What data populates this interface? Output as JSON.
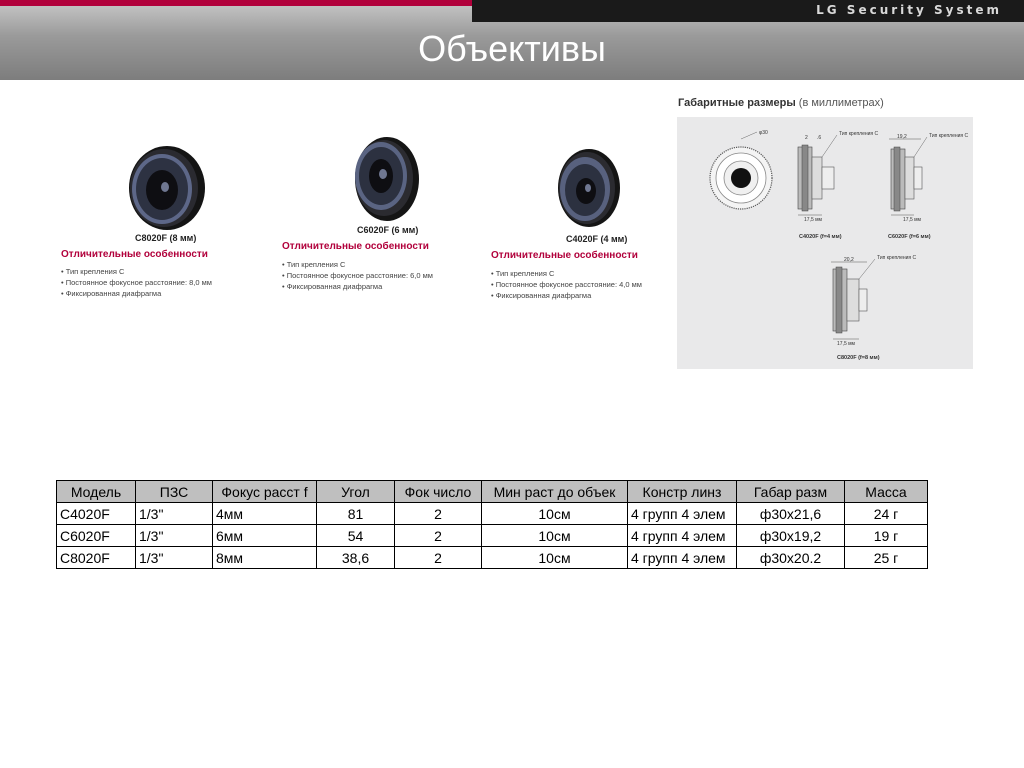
{
  "header": {
    "brand": "LG Security System",
    "title": "Объективы"
  },
  "products": [
    {
      "model_caption": "C8020F (8 мм)",
      "features_title": "Отличительные особенности",
      "features": [
        "Тип крепления C",
        "Постоянное фокусное расстояние: 8,0 мм",
        "Фиксированная диафрагма"
      ]
    },
    {
      "model_caption": "C6020F (6 мм)",
      "features_title": "Отличительные особенности",
      "features": [
        "Тип крепления C",
        "Постоянное фокусное расстояние: 6,0 мм",
        "Фиксированная диафрагма"
      ]
    },
    {
      "model_caption": "C4020F (4 мм)",
      "features_title": "Отличительные особенности",
      "features": [
        "Тип крепления C",
        "Постоянное фокусное расстояние: 4,0 мм",
        "Фиксированная диафрагма"
      ]
    }
  ],
  "dimensions": {
    "title": "Габаритные размеры",
    "subtitle": "(в миллиметрах)",
    "labels": {
      "phi30": "φ30",
      "two": "2",
      "six": ".6",
      "mount": "Тип крепления C",
      "d19": "19,2",
      "d20": "20,2",
      "w175": "17,5 мм"
    },
    "captions": [
      "C4020F (f=4 мм)",
      "C6020F (f=6 мм)",
      "C8020F (f=8 мм)"
    ]
  },
  "table": {
    "headers": [
      "Модель",
      "ПЗС",
      "Фокус расст f",
      "Угол",
      "Фок число",
      "Мин раст до объек",
      "Констр линз",
      "Габар разм",
      "Масса"
    ],
    "rows": [
      [
        "C4020F",
        "1/3\"",
        "4мм",
        "81",
        "2",
        "10см",
        "4 групп 4 элем",
        "ф30x21,6",
        "24 г"
      ],
      [
        "C6020F",
        "1/3\"",
        "6мм",
        "54",
        "2",
        "10см",
        "4 групп 4 элем",
        "ф30x19,2",
        "19 г"
      ],
      [
        "C8020F",
        "1/3\"",
        "8мм",
        "38,6",
        "2",
        "10см",
        "4 групп 4 элем",
        "ф30x20.2",
        "25 г"
      ]
    ]
  }
}
